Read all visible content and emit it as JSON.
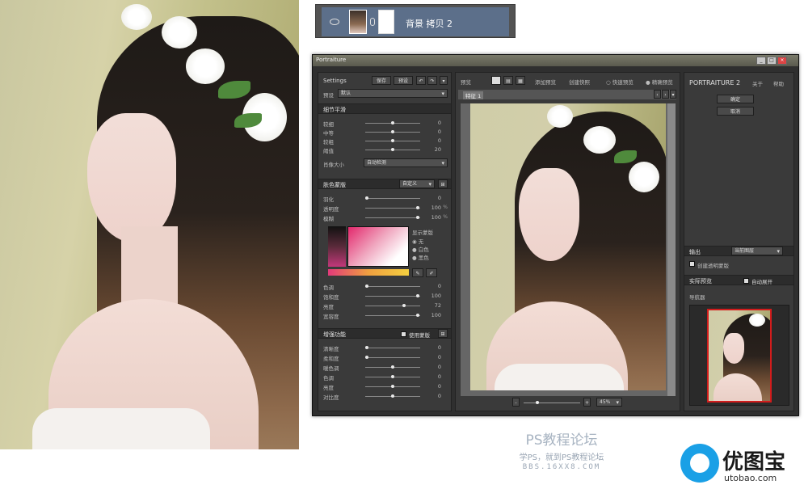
{
  "layer": {
    "name": "背景 拷贝 2"
  },
  "window": {
    "title": "Portraiture"
  },
  "left": {
    "settings_label": "Settings",
    "save": "保存",
    "preset": "预设",
    "preset_label": "预设",
    "preset_value": "默认",
    "detail_title": "细节平滑",
    "detail": [
      {
        "label": "较细",
        "value": "0",
        "pos": 0.5
      },
      {
        "label": "中等",
        "value": "0",
        "pos": 0.5
      },
      {
        "label": "较粗",
        "value": "0",
        "pos": 0.5
      },
      {
        "label": "阈值",
        "value": "20",
        "pos": 0.5
      }
    ],
    "size_label": "肖像大小",
    "size_value": "自动检测",
    "mask_title": "肤色蒙版",
    "mask_mode": "自定义",
    "mask": [
      {
        "label": "羽化",
        "value": "0",
        "unit": "",
        "pos": 0.0
      },
      {
        "label": "透明度",
        "value": "100",
        "unit": "%",
        "pos": 0.98
      },
      {
        "label": "模糊",
        "value": "100",
        "unit": "%",
        "pos": 0.98
      }
    ],
    "show_mask": "显示蒙版",
    "radio": [
      "无",
      "白色",
      "黑色"
    ],
    "hue": [
      {
        "label": "色调",
        "value": "0",
        "pos": 0.0
      },
      {
        "label": "饱和度",
        "value": "100",
        "pos": 0.98
      },
      {
        "label": "亮度",
        "value": "72",
        "pos": 0.72
      },
      {
        "label": "宽容度",
        "value": "100",
        "pos": 0.98
      }
    ],
    "enhance_title": "增强功能",
    "use_mask": "使用蒙版",
    "enhance": [
      {
        "label": "清晰度",
        "value": "0",
        "pos": 0.0
      },
      {
        "label": "柔和度",
        "value": "0",
        "pos": 0.0
      },
      {
        "label": "暖色调",
        "value": "0",
        "pos": 0.5
      },
      {
        "label": "色调",
        "value": "0",
        "pos": 0.5
      },
      {
        "label": "亮度",
        "value": "0",
        "pos": 0.5
      },
      {
        "label": "对比度",
        "value": "0",
        "pos": 0.5
      }
    ]
  },
  "mid": {
    "toolbar_label": "预览",
    "add_preview": "添加预览",
    "create_snapshot": "创建快照",
    "fast_preview": "快速预览",
    "precise_preview": "精确预览",
    "tab": "特征 1",
    "zoom": "45%"
  },
  "right": {
    "brand": "PORTRAITURE 2",
    "about": "关于",
    "help": "帮助",
    "ok": "确定",
    "cancel": "取消",
    "output_title": "输出",
    "output_value": "当前图层",
    "transparent_mask": "创建透明蒙版",
    "compare_title": "实际预览",
    "auto_expand": "自动展开",
    "navigator": "导航器"
  },
  "caption": {
    "line1": "PS教程论坛",
    "line2": "学PS，就到PS教程论坛",
    "line3": "BBS.16XX8.COM"
  },
  "logo": {
    "name": "优图宝",
    "url": "utobao.com"
  }
}
